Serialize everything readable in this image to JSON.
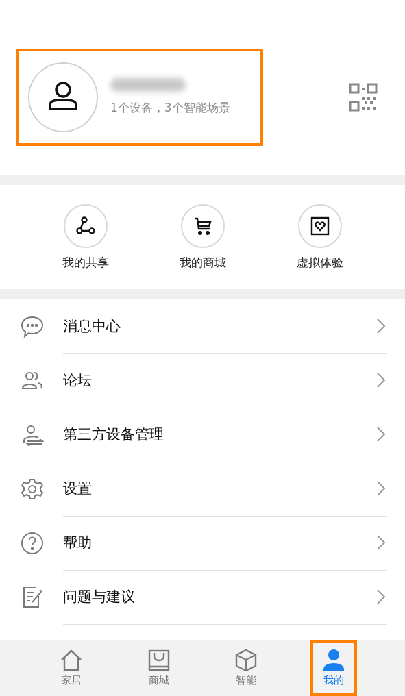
{
  "profile": {
    "summary": "1个设备，3个智能场景",
    "highlighted": true
  },
  "shortcuts": [
    {
      "kind": "share",
      "label": "我的共享"
    },
    {
      "kind": "cart",
      "label": "我的商城"
    },
    {
      "kind": "heart",
      "label": "虚拟体验"
    }
  ],
  "menu": [
    {
      "kind": "chat",
      "label": "消息中心"
    },
    {
      "kind": "people",
      "label": "论坛"
    },
    {
      "kind": "transfer",
      "label": "第三方设备管理"
    },
    {
      "kind": "gear",
      "label": "设置"
    },
    {
      "kind": "help",
      "label": "帮助"
    },
    {
      "kind": "edit",
      "label": "问题与建议"
    }
  ],
  "tabs": [
    {
      "kind": "home",
      "label": "家居",
      "selected": false,
      "highlighted": false
    },
    {
      "kind": "store",
      "label": "商城",
      "selected": false,
      "highlighted": false
    },
    {
      "kind": "cube",
      "label": "智能",
      "selected": false,
      "highlighted": false
    },
    {
      "kind": "person",
      "label": "我的",
      "selected": true,
      "highlighted": true
    }
  ]
}
